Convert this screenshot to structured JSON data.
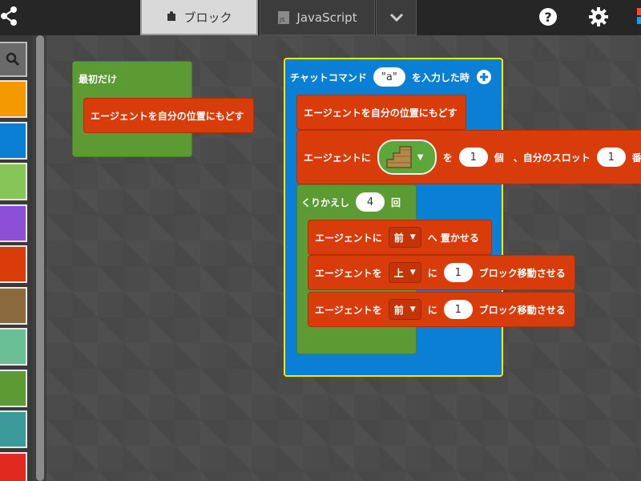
{
  "tabs": {
    "blocks_label": "ブロック",
    "js_label": "JavaScript",
    "more_icon": "chevron-down-icon"
  },
  "icons": {
    "share": "share-icon",
    "help": "help-icon",
    "settings": "gear-icon",
    "search": "search-icon"
  },
  "colors": {
    "topbar": "#262626",
    "selected_tab": "#d9d9d9",
    "workspace": "#4b4b4b",
    "loops_green": "#5c9b33",
    "agent_red": "#d83c0a",
    "player_blue": "#0a7fd4",
    "highlight_yellow": "#ffe500"
  },
  "toolbox": {
    "categories": [
      {
        "name": "player",
        "color": "#f49a00"
      },
      {
        "name": "blocks",
        "color": "#0a7fd4"
      },
      {
        "name": "mobs",
        "color": "#86c659"
      },
      {
        "name": "agent-purple",
        "color": "#8c4fd6"
      },
      {
        "name": "agent",
        "color": "#d83c0a"
      },
      {
        "name": "builder",
        "color": "#8b6a3e"
      },
      {
        "name": "shapes",
        "color": "#6abf96"
      },
      {
        "name": "loops",
        "color": "#5c9b33"
      },
      {
        "name": "logic",
        "color": "#3d9a9a"
      },
      {
        "name": "variables",
        "color": "#e02a20"
      }
    ]
  },
  "blocks": {
    "on_start": {
      "label": "最初だけ",
      "inner": "エージェントを自分の位置にもどす"
    },
    "chat": {
      "label": "チャットコマンド",
      "arg": "\"a\"",
      "suffix": "を入力した時",
      "add_icon": "plus-circle-icon",
      "teleport": "エージェントを自分の位置にもどす",
      "set_item_prefix": "エージェントに",
      "set_item_icon": "stairs-icon",
      "set_item_count_label": "を",
      "set_item_count": "1",
      "set_item_unit": "個　、自分のスロット",
      "set_item_slot": "1",
      "set_item_suffix": "番",
      "repeat_label": "くりかえし",
      "repeat_count": "4",
      "repeat_unit": "回",
      "place_prefix": "エージェントに",
      "place_dir": "前",
      "place_suffix": "へ 置かせる",
      "move1_prefix": "エージェントを",
      "move1_dir": "上",
      "move1_ni": "に",
      "move1_count": "1",
      "move1_suffix": "ブロック移動させる",
      "move2_prefix": "エージェントを",
      "move2_dir": "前",
      "move2_ni": "に",
      "move2_count": "1",
      "move2_suffix": "ブロック移動させる"
    }
  }
}
